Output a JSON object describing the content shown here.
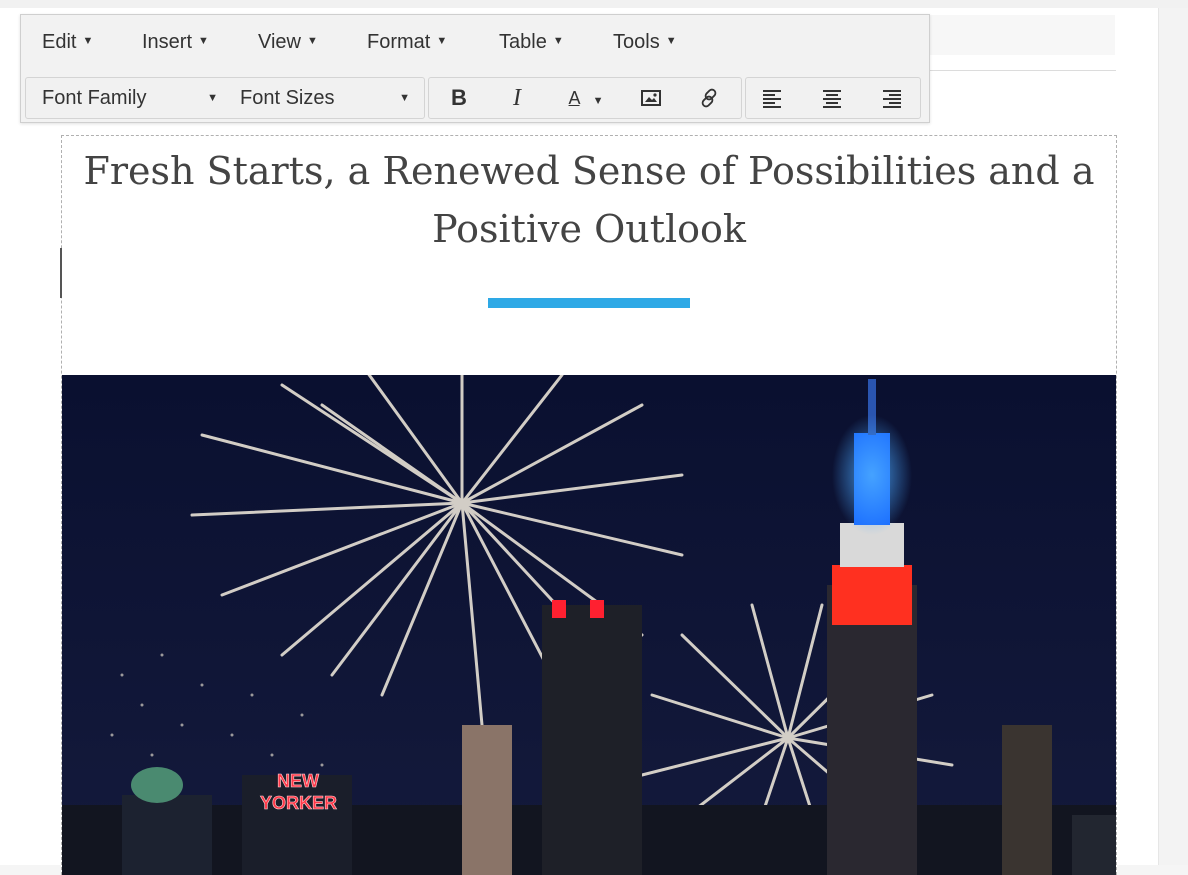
{
  "menubar": {
    "items": [
      {
        "label": "Edit"
      },
      {
        "label": "Insert"
      },
      {
        "label": "View"
      },
      {
        "label": "Format"
      },
      {
        "label": "Table"
      },
      {
        "label": "Tools"
      }
    ]
  },
  "toolbar": {
    "font_family_label": "Font Family",
    "font_sizes_label": "Font Sizes",
    "bold_label": "B",
    "italic_label": "I",
    "text_color_label": "A",
    "buttons": [
      "bold",
      "italic",
      "text-color",
      "insert-image",
      "insert-link",
      "align-left",
      "align-center",
      "align-right"
    ]
  },
  "document": {
    "headline": "Fresh Starts, a Renewed Sense of Possibilities and a Positive Outlook",
    "accent_color": "#2ea9e6",
    "hero_image_sign": [
      "NEW",
      "YORKER"
    ]
  },
  "icons": [
    "chevron-down-icon",
    "image-icon",
    "link-icon",
    "align-left-icon",
    "align-center-icon",
    "align-right-icon"
  ]
}
